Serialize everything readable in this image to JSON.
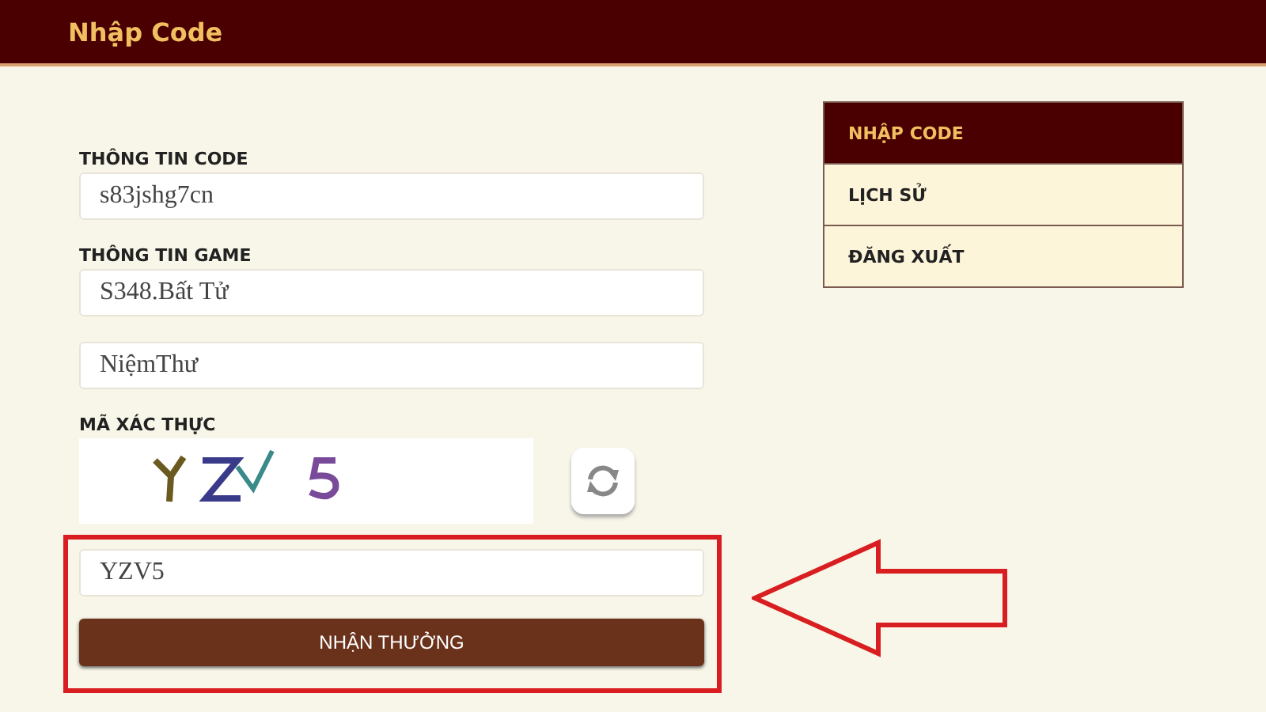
{
  "header": {
    "title": "Nhập Code"
  },
  "form": {
    "fields": [
      {
        "label": "THÔNG TIN CODE",
        "value": "s83jshg7cn"
      },
      {
        "label": "THÔNG TIN GAME",
        "value": "S348.Bất Tử"
      },
      {
        "value": "NiệmThư"
      }
    ],
    "captcha": {
      "label": "MÃ XÁC THỰC",
      "answer": "YZV5"
    },
    "submit": "NHẬN THƯỞNG"
  },
  "menu": [
    {
      "label": "NHẬP CODE",
      "selected": true
    },
    {
      "label": "LỊCH SỬ",
      "selected": false
    },
    {
      "label": "ĐĂNG XUẤT",
      "selected": false
    }
  ],
  "annotation": {
    "highlight": true,
    "arrow": true
  }
}
